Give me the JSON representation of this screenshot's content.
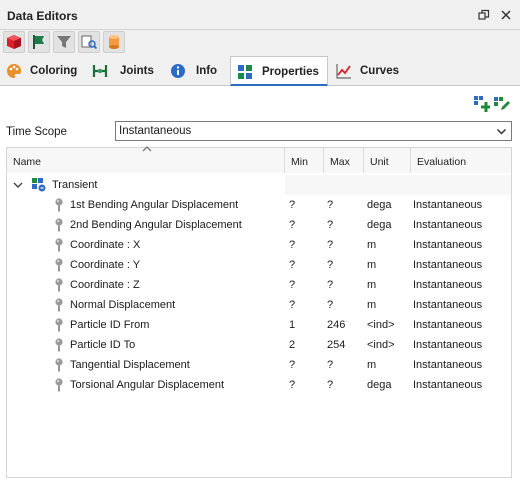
{
  "window": {
    "title": "Data Editors"
  },
  "toolbar": {
    "buttons": [
      {
        "icon": "red-cube-icon"
      },
      {
        "icon": "green-flag-icon"
      },
      {
        "icon": "filter-icon"
      },
      {
        "icon": "find-icon"
      },
      {
        "icon": "cylinder-icon"
      }
    ]
  },
  "tabs": [
    {
      "label": "Coloring",
      "icon": "palette-icon"
    },
    {
      "label": "Joints",
      "icon": "joints-icon"
    },
    {
      "label": "Info",
      "icon": "info-icon"
    },
    {
      "label": "Properties",
      "icon": "properties-icon",
      "active": true
    },
    {
      "label": "Curves",
      "icon": "curves-icon"
    }
  ],
  "time_scope": {
    "label": "Time Scope",
    "value": "Instantaneous"
  },
  "grid": {
    "columns": [
      "Name",
      "Min",
      "Max",
      "Unit",
      "Evaluation"
    ],
    "group": {
      "label": "Transient"
    },
    "rows": [
      {
        "name": "1st Bending Angular Displacement",
        "min": "?",
        "max": "?",
        "unit": "dega",
        "eval": "Instantaneous"
      },
      {
        "name": "2nd Bending Angular Displacement",
        "min": "?",
        "max": "?",
        "unit": "dega",
        "eval": "Instantaneous"
      },
      {
        "name": "Coordinate : X",
        "min": "?",
        "max": "?",
        "unit": "m",
        "eval": "Instantaneous"
      },
      {
        "name": "Coordinate : Y",
        "min": "?",
        "max": "?",
        "unit": "m",
        "eval": "Instantaneous"
      },
      {
        "name": "Coordinate : Z",
        "min": "?",
        "max": "?",
        "unit": "m",
        "eval": "Instantaneous"
      },
      {
        "name": "Normal Displacement",
        "min": "?",
        "max": "?",
        "unit": "m",
        "eval": "Instantaneous"
      },
      {
        "name": "Particle ID From",
        "min": "1",
        "max": "246",
        "unit": "<ind>",
        "eval": "Instantaneous"
      },
      {
        "name": "Particle ID To",
        "min": "2",
        "max": "254",
        "unit": "<ind>",
        "eval": "Instantaneous"
      },
      {
        "name": "Tangential Displacement",
        "min": "?",
        "max": "?",
        "unit": "m",
        "eval": "Instantaneous"
      },
      {
        "name": "Torsional Angular Displacement",
        "min": "?",
        "max": "?",
        "unit": "dega",
        "eval": "Instantaneous"
      }
    ]
  }
}
